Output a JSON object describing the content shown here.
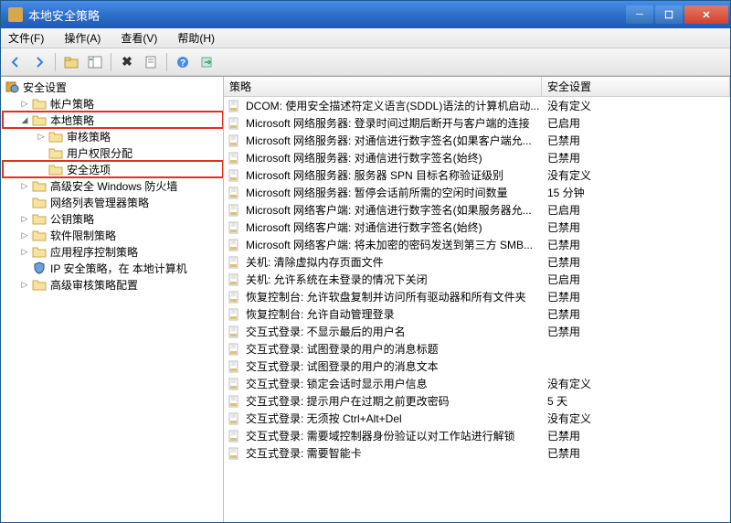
{
  "window": {
    "title": "本地安全策略"
  },
  "menus": {
    "file": "文件(F)",
    "action": "操作(A)",
    "view": "查看(V)",
    "help": "帮助(H)"
  },
  "tree": {
    "root": "安全设置",
    "items": [
      {
        "label": "帐户策略",
        "depth": 1,
        "expandable": true,
        "open": false
      },
      {
        "label": "本地策略",
        "depth": 1,
        "expandable": true,
        "open": true,
        "highlight": true
      },
      {
        "label": "审核策略",
        "depth": 2,
        "expandable": true,
        "open": false
      },
      {
        "label": "用户权限分配",
        "depth": 2,
        "expandable": false
      },
      {
        "label": "安全选项",
        "depth": 2,
        "expandable": false,
        "highlight": true
      },
      {
        "label": "高级安全 Windows 防火墙",
        "depth": 1,
        "expandable": true,
        "open": false
      },
      {
        "label": "网络列表管理器策略",
        "depth": 1,
        "expandable": false
      },
      {
        "label": "公钥策略",
        "depth": 1,
        "expandable": true,
        "open": false
      },
      {
        "label": "软件限制策略",
        "depth": 1,
        "expandable": true,
        "open": false
      },
      {
        "label": "应用程序控制策略",
        "depth": 1,
        "expandable": true,
        "open": false
      },
      {
        "label": "IP 安全策略，在 本地计算机",
        "depth": 1,
        "expandable": false,
        "iconType": "shield"
      },
      {
        "label": "高级审核策略配置",
        "depth": 1,
        "expandable": true,
        "open": false
      }
    ]
  },
  "list": {
    "columns": {
      "policy": "策略",
      "setting": "安全设置"
    },
    "rows": [
      {
        "policy": "DCOM: 使用安全描述符定义语言(SDDL)语法的计算机启动...",
        "setting": "没有定义"
      },
      {
        "policy": "Microsoft 网络服务器: 登录时间过期后断开与客户端的连接",
        "setting": "已启用"
      },
      {
        "policy": "Microsoft 网络服务器: 对通信进行数字签名(如果客户端允...",
        "setting": "已禁用"
      },
      {
        "policy": "Microsoft 网络服务器: 对通信进行数字签名(始终)",
        "setting": "已禁用"
      },
      {
        "policy": "Microsoft 网络服务器: 服务器 SPN 目标名称验证级别",
        "setting": "没有定义"
      },
      {
        "policy": "Microsoft 网络服务器: 暂停会话前所需的空闲时间数量",
        "setting": "15 分钟"
      },
      {
        "policy": "Microsoft 网络客户端: 对通信进行数字签名(如果服务器允...",
        "setting": "已启用"
      },
      {
        "policy": "Microsoft 网络客户端: 对通信进行数字签名(始终)",
        "setting": "已禁用"
      },
      {
        "policy": "Microsoft 网络客户端: 将未加密的密码发送到第三方 SMB...",
        "setting": "已禁用"
      },
      {
        "policy": "关机: 清除虚拟内存页面文件",
        "setting": "已禁用"
      },
      {
        "policy": "关机: 允许系统在未登录的情况下关闭",
        "setting": "已启用"
      },
      {
        "policy": "恢复控制台: 允许软盘复制并访问所有驱动器和所有文件夹",
        "setting": "已禁用"
      },
      {
        "policy": "恢复控制台: 允许自动管理登录",
        "setting": "已禁用"
      },
      {
        "policy": "交互式登录: 不显示最后的用户名",
        "setting": "已禁用"
      },
      {
        "policy": "交互式登录: 试图登录的用户的消息标题",
        "setting": ""
      },
      {
        "policy": "交互式登录: 试图登录的用户的消息文本",
        "setting": ""
      },
      {
        "policy": "交互式登录: 锁定会话时显示用户信息",
        "setting": "没有定义"
      },
      {
        "policy": "交互式登录: 提示用户在过期之前更改密码",
        "setting": "5 天"
      },
      {
        "policy": "交互式登录: 无须按 Ctrl+Alt+Del",
        "setting": "没有定义"
      },
      {
        "policy": "交互式登录: 需要域控制器身份验证以对工作站进行解锁",
        "setting": "已禁用"
      },
      {
        "policy": "交互式登录: 需要智能卡",
        "setting": "已禁用"
      }
    ]
  }
}
